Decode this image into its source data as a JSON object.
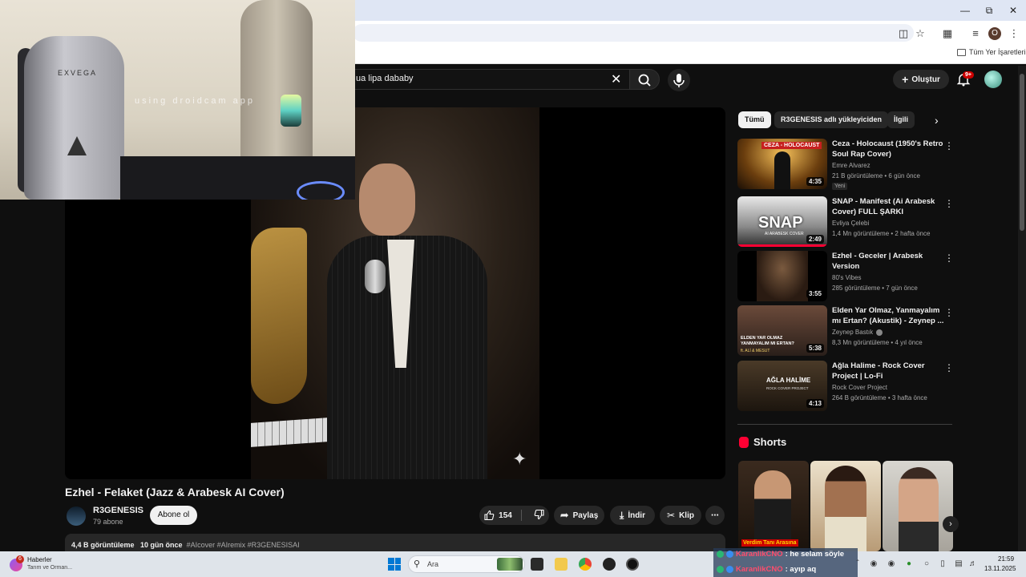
{
  "browser": {
    "bookmarks_label": "Tüm Yer İşaretleri",
    "profile_initial": "O"
  },
  "search": {
    "query": "ua lipa dababy"
  },
  "header": {
    "create_label": "Oluştur",
    "notifications_count": "9+"
  },
  "webcam": {
    "chair_brand": "EXVEGA",
    "watermark": "using droidcam app"
  },
  "video": {
    "title": "Ezhel - Felaket (Jazz & Arabesk AI Cover)",
    "channel": "R3GENESIS",
    "subscribers": "79 abone",
    "subscribe_label": "Abone ol",
    "likes": "154",
    "share_label": "Paylaş",
    "download_label": "İndir",
    "clip_label": "Klip",
    "views": "4,4 B görüntüleme",
    "age": "10 gün önce",
    "tags": "#AIcover #AIremix #R3GENESISAI"
  },
  "chips": [
    "Tümü",
    "R3GENESIS adlı yükleyiciden",
    "İlgili"
  ],
  "recommendations": [
    {
      "title": "Ceza - Holocaust (1950's Retro Soul Rap Cover)",
      "channel": "Emre Alvarez",
      "meta": "21 B görüntüleme • 6 gün önce",
      "badge": "Yeni",
      "duration": "4:35",
      "thumb_text": "CEZA - HOLOCAUST"
    },
    {
      "title": "SNAP - Manifest (Ai Arabesk Cover) FULL ŞARKI",
      "channel": "Evliya Çelebi",
      "meta": "1,4 Mn görüntüleme • 2 hafta önce",
      "badge": "",
      "duration": "2:49",
      "thumb_text": "SNAP",
      "thumb_sub": "AI ARABESK COVER"
    },
    {
      "title": "Ezhel - Geceler | Arabesk Version",
      "channel": "80's Vibes",
      "meta": "285 görüntüleme • 7 gün önce",
      "badge": "",
      "duration": "3:55"
    },
    {
      "title": "Elden Yar Olmaz, Yanmayalım mı Ertan? (Akustik) - Zeynep ...",
      "channel": "Zeynep Bastık",
      "meta": "8,3 Mn görüntüleme • 4 yıl önce",
      "badge": "",
      "duration": "5:38",
      "thumb_text": "ELDEN YAR OLMAZ YANMAYALIM MI ERTAN?",
      "thumb_sub": "ft. ALİ & MESUT"
    },
    {
      "title": "Ağla Halime - Rock Cover Project | Lo-Fi",
      "channel": "Rock Cover Project",
      "meta": "264 B görüntüleme • 3 hafta önce",
      "badge": "",
      "duration": "4:13",
      "thumb_text": "AĞLA HALİME",
      "thumb_sub": "ROCK COVER PROJECT"
    }
  ],
  "shorts": {
    "heading": "Shorts",
    "first_caption": "Verdim Tanı Arasına"
  },
  "taskbar": {
    "news_title": "Haberler",
    "news_sub": "Tarım ve Orman...",
    "news_badge": "6",
    "search_placeholder": "Ara",
    "time": "21:59",
    "date": "13.11.2025"
  },
  "chat": [
    {
      "user": "KaranlikCNO",
      "message": ": he selam söyle"
    },
    {
      "user": "KaranlikCNO",
      "message": ": ayıp aq"
    }
  ],
  "colors": {
    "yt_bg": "#0f0f0f",
    "chip_bg": "#272727",
    "accent_red": "#ff0033",
    "chat_user": "#ff4d6d"
  }
}
